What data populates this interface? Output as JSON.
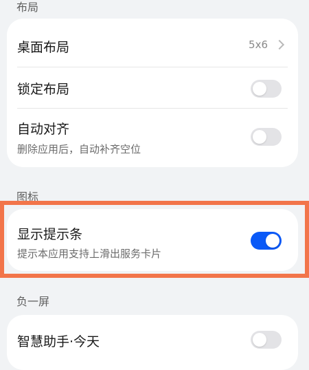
{
  "sections": {
    "layout_header": "布局",
    "icons_header": "图标",
    "minus_one_header": "负一屏"
  },
  "layout_card": {
    "desktop_layout": {
      "title": "桌面布局",
      "value": "5x6"
    },
    "lock_layout": {
      "title": "锁定布局",
      "enabled": false
    },
    "auto_align": {
      "title": "自动对齐",
      "subtitle": "删除应用后，自动补齐空位",
      "enabled": false
    }
  },
  "icons_card": {
    "show_hint_bar": {
      "title": "显示提示条",
      "subtitle": "提示本应用支持上滑出服务卡片",
      "enabled": true
    }
  },
  "minus_one_card": {
    "smart_assistant": {
      "title": "智慧助手·今天",
      "enabled": false
    }
  },
  "colors": {
    "accent": "#0a59f7",
    "highlight_border": "#f2754a",
    "background": "#f1f3f5"
  }
}
